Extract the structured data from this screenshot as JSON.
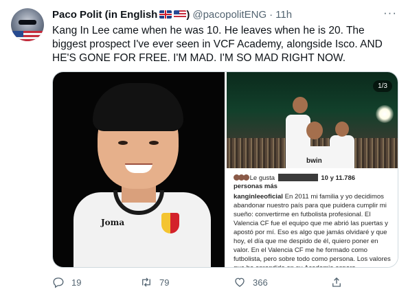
{
  "tweet": {
    "author_name": "Paco Polit (in English",
    "name_suffix": ")",
    "handle": "@pacopolitENG",
    "separator": "·",
    "time": "11h",
    "more_label": "···",
    "text": "Kang In Lee came when he was 10. He leaves when he is 20. The biggest prospect I've ever seen in VCF Academy, alongside Isco. AND HE'S GONE FOR FREE. I'M MAD. I'M SO MAD RIGHT NOW."
  },
  "media": {
    "left_image": {
      "jersey_brand": "Joma",
      "crest": "valencia-cf-crest"
    },
    "right_image": {
      "counter": "1/3",
      "sponsor": "bwin",
      "likes_prefix": "Le gusta",
      "likes_suffix": "10 y 11.786",
      "likes_tail": "personas más",
      "caption_user": "kanginleeoficial",
      "caption_text": " En 2011 mi familia y yo decidimos abandonar nuestro país para que puidera cumplir mi sueño: convertirme en futbolista profesional. El Valencia CF fue el equipo que me abrió las puertas y apostó por mí. Eso es algo que jamás olvidaré y que hoy, el día que me despido de él, quiero poner en valor. En el Valencia CF me he formado como futbolista, pero sobre todo como persona. Los valores que he aprendido en su Academia espero"
    }
  },
  "actions": {
    "reply_count": "19",
    "retweet_count": "79",
    "like_count": "366"
  },
  "icons": {
    "reply": "reply-icon",
    "retweet": "retweet-icon",
    "like": "heart-icon",
    "share": "share-icon",
    "flag_uk": "uk-flag-icon",
    "flag_us": "us-flag-icon"
  },
  "colors": {
    "text": "#0f1419",
    "secondary": "#536471",
    "border": "#cfd9de"
  }
}
